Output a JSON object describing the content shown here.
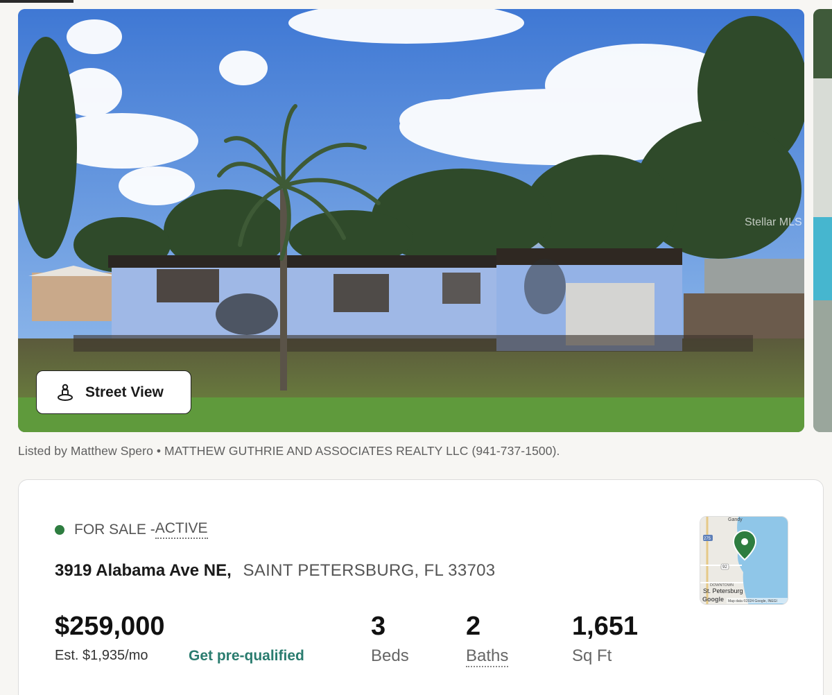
{
  "gallery": {
    "watermark": "Stellar MLS",
    "street_view_label": "Street View"
  },
  "listing": {
    "listed_by": "Listed by Matthew Spero • MATTHEW GUTHRIE AND ASSOCIATES REALTY LLC (941-737-1500).",
    "status_prefix": "FOR SALE - ",
    "status_value": "ACTIVE",
    "status_color": "#2e7d40",
    "street": "3919 Alabama Ave NE,",
    "city_state_zip": "SAINT PETERSBURG, FL 33703",
    "price": "$259,000",
    "est_payment": "Est. $1,935/mo",
    "prequal_label": "Get pre-qualified",
    "accent_color": "#2a7c6f",
    "beds_value": "3",
    "beds_label": "Beds",
    "baths_value": "2",
    "baths_label": "Baths",
    "sqft_value": "1,651",
    "sqft_label": "Sq Ft"
  },
  "map": {
    "label_gandy": "Gandy",
    "label_downtown": "DOWNTOWN",
    "label_city": "St. Petersburg",
    "label_highway_275": "275",
    "label_highway_92": "92",
    "label_google": "Google",
    "attribution": "Map data ©2024 Google, INEGI",
    "pin_icon": "map-pin-icon"
  }
}
